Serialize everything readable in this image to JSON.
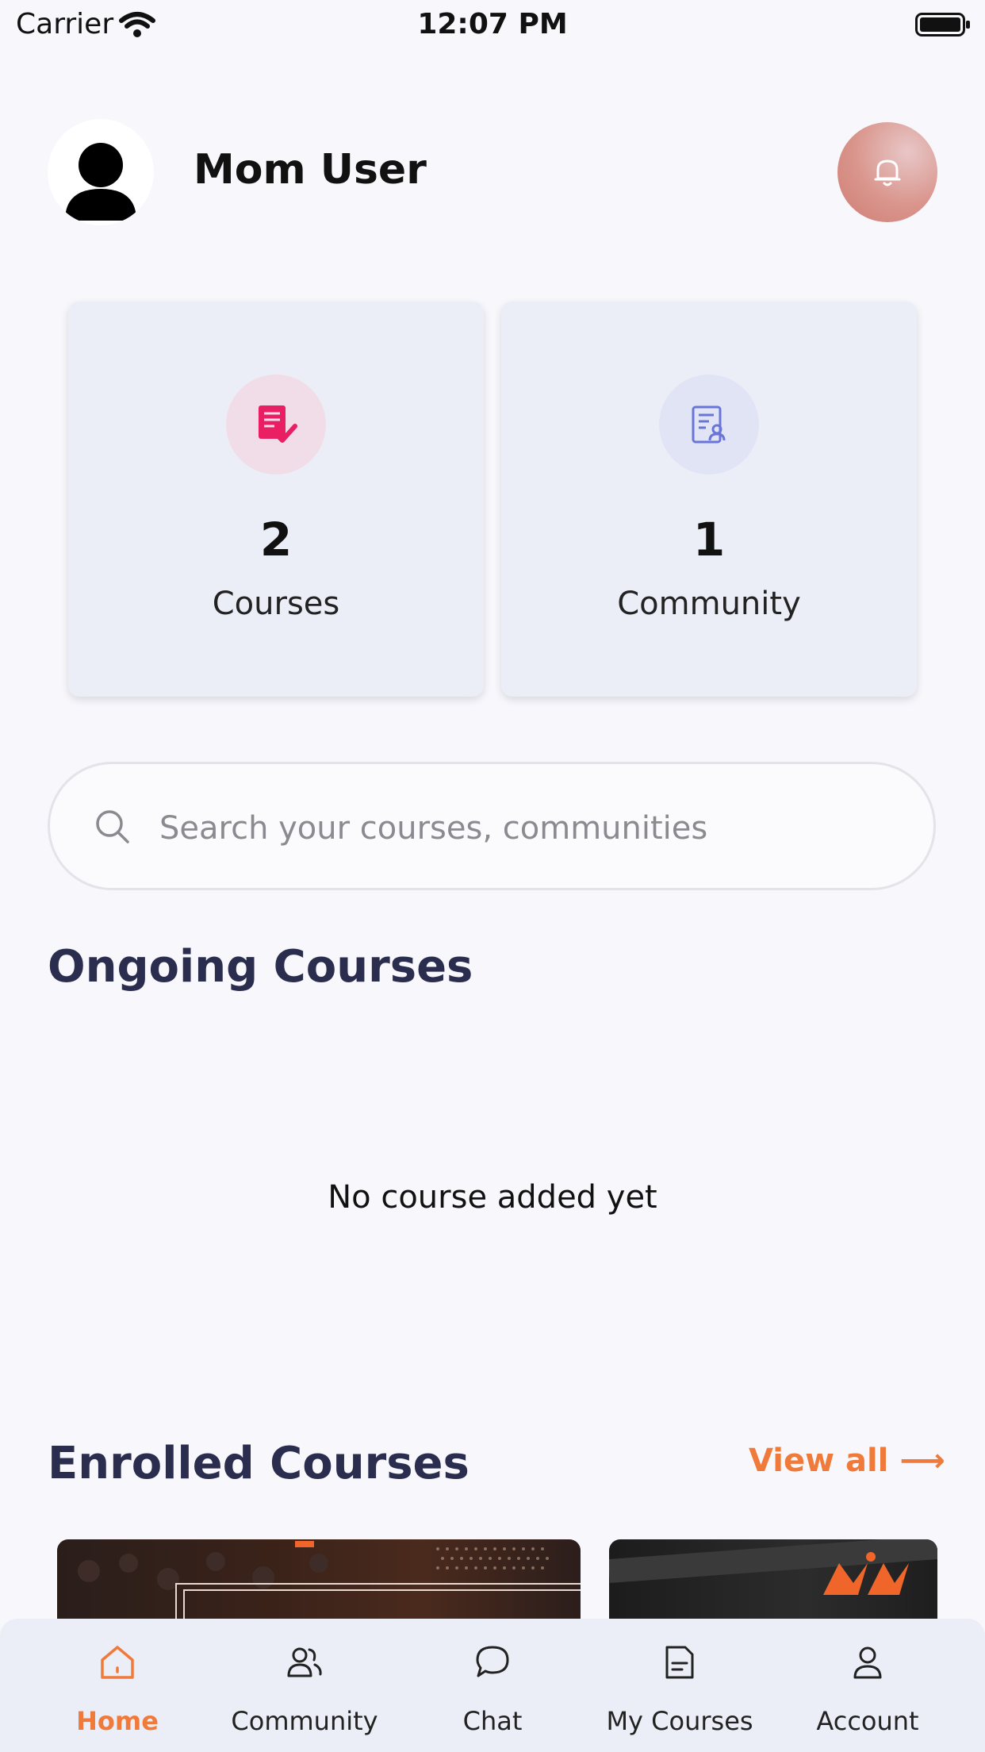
{
  "status_bar": {
    "carrier": "Carrier",
    "time": "12:07 PM"
  },
  "header": {
    "user_name": "Mom User",
    "avatar_icon": "user-silhouette-icon",
    "bell_icon": "bell-icon"
  },
  "stats": [
    {
      "value": "2",
      "label": "Courses",
      "icon": "checklist-icon",
      "accent": "#e91e63"
    },
    {
      "value": "1",
      "label": "Community",
      "icon": "document-user-icon",
      "accent": "#6a75d8"
    }
  ],
  "search": {
    "placeholder": "Search your courses, communities"
  },
  "ongoing": {
    "title": "Ongoing Courses",
    "empty_text": "No course added yet"
  },
  "enrolled": {
    "title": "Enrolled Courses",
    "view_all": "View all ⟶"
  },
  "tabs": [
    {
      "label": "Home",
      "icon": "home-icon",
      "active": true
    },
    {
      "label": "Community",
      "icon": "users-icon",
      "active": false
    },
    {
      "label": "Chat",
      "icon": "chat-icon",
      "active": false
    },
    {
      "label": "My Courses",
      "icon": "document-icon",
      "active": false
    },
    {
      "label": "Account",
      "icon": "user-icon",
      "active": false
    }
  ],
  "colors": {
    "accent": "#f07a3a",
    "heading": "#2b2d4f",
    "background": "#f7f7fc"
  }
}
